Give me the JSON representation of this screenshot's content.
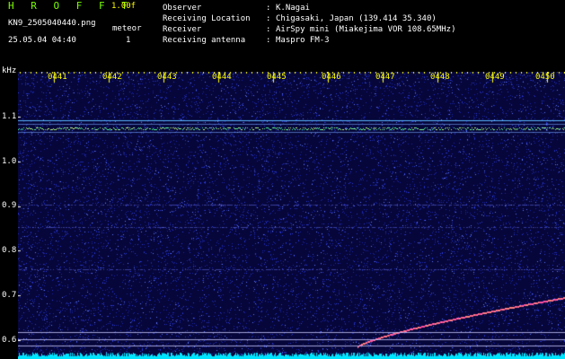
{
  "header": {
    "app_title": "H R O F F T",
    "version": "1.00f",
    "filename": "KN9_2505040440.png",
    "meteor_label": "meteor",
    "meteor_count": "1",
    "datetime": "25.05.04 04:40",
    "info": [
      {
        "key": "Observer",
        "value": "K.Nagai"
      },
      {
        "key": "Receiving Location",
        "value": "Chigasaki, Japan (139.414 35.340)"
      },
      {
        "key": "Receiver",
        "value": "AirSpy mini (Miakejima VOR 108.65MHz)"
      },
      {
        "key": "Receiving antenna",
        "value": "Maspro FM-3"
      }
    ]
  },
  "plot": {
    "y_unit": "kHz",
    "y_ticks": [
      "1.1",
      "1.0",
      "0.9",
      "0.8",
      "0.7",
      "0.6"
    ],
    "time_labels": [
      "0441",
      "0442",
      "0443",
      "0444",
      "0445",
      "0446",
      "0447",
      "0448",
      "0449",
      "0450"
    ],
    "colors": {
      "background": "#06063a",
      "noise": "#2c3bd6",
      "carrier": "#c8ff80",
      "trace": "#ff8080",
      "baseline": "#00e5ff",
      "label": "#ffff00"
    }
  }
}
